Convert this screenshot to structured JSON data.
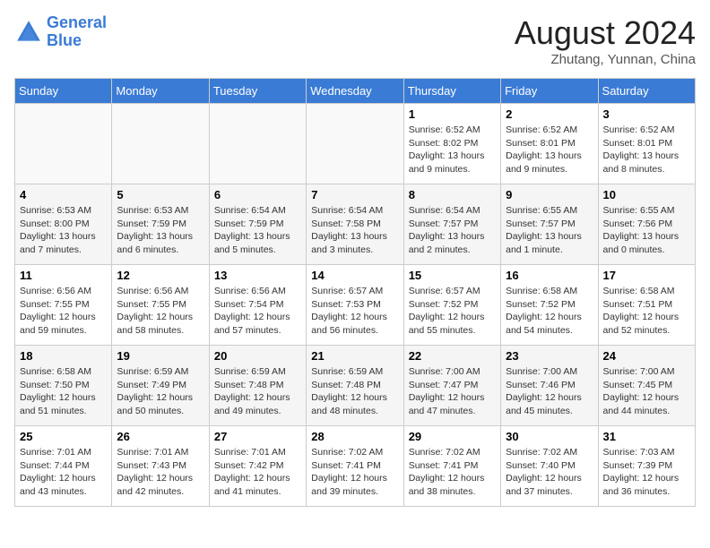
{
  "header": {
    "logo_line1": "General",
    "logo_line2": "Blue",
    "month": "August 2024",
    "location": "Zhutang, Yunnan, China"
  },
  "weekdays": [
    "Sunday",
    "Monday",
    "Tuesday",
    "Wednesday",
    "Thursday",
    "Friday",
    "Saturday"
  ],
  "weeks": [
    [
      {
        "day": "",
        "info": ""
      },
      {
        "day": "",
        "info": ""
      },
      {
        "day": "",
        "info": ""
      },
      {
        "day": "",
        "info": ""
      },
      {
        "day": "1",
        "info": "Sunrise: 6:52 AM\nSunset: 8:02 PM\nDaylight: 13 hours\nand 9 minutes."
      },
      {
        "day": "2",
        "info": "Sunrise: 6:52 AM\nSunset: 8:01 PM\nDaylight: 13 hours\nand 9 minutes."
      },
      {
        "day": "3",
        "info": "Sunrise: 6:52 AM\nSunset: 8:01 PM\nDaylight: 13 hours\nand 8 minutes."
      }
    ],
    [
      {
        "day": "4",
        "info": "Sunrise: 6:53 AM\nSunset: 8:00 PM\nDaylight: 13 hours\nand 7 minutes."
      },
      {
        "day": "5",
        "info": "Sunrise: 6:53 AM\nSunset: 7:59 PM\nDaylight: 13 hours\nand 6 minutes."
      },
      {
        "day": "6",
        "info": "Sunrise: 6:54 AM\nSunset: 7:59 PM\nDaylight: 13 hours\nand 5 minutes."
      },
      {
        "day": "7",
        "info": "Sunrise: 6:54 AM\nSunset: 7:58 PM\nDaylight: 13 hours\nand 3 minutes."
      },
      {
        "day": "8",
        "info": "Sunrise: 6:54 AM\nSunset: 7:57 PM\nDaylight: 13 hours\nand 2 minutes."
      },
      {
        "day": "9",
        "info": "Sunrise: 6:55 AM\nSunset: 7:57 PM\nDaylight: 13 hours\nand 1 minute."
      },
      {
        "day": "10",
        "info": "Sunrise: 6:55 AM\nSunset: 7:56 PM\nDaylight: 13 hours\nand 0 minutes."
      }
    ],
    [
      {
        "day": "11",
        "info": "Sunrise: 6:56 AM\nSunset: 7:55 PM\nDaylight: 12 hours\nand 59 minutes."
      },
      {
        "day": "12",
        "info": "Sunrise: 6:56 AM\nSunset: 7:55 PM\nDaylight: 12 hours\nand 58 minutes."
      },
      {
        "day": "13",
        "info": "Sunrise: 6:56 AM\nSunset: 7:54 PM\nDaylight: 12 hours\nand 57 minutes."
      },
      {
        "day": "14",
        "info": "Sunrise: 6:57 AM\nSunset: 7:53 PM\nDaylight: 12 hours\nand 56 minutes."
      },
      {
        "day": "15",
        "info": "Sunrise: 6:57 AM\nSunset: 7:52 PM\nDaylight: 12 hours\nand 55 minutes."
      },
      {
        "day": "16",
        "info": "Sunrise: 6:58 AM\nSunset: 7:52 PM\nDaylight: 12 hours\nand 54 minutes."
      },
      {
        "day": "17",
        "info": "Sunrise: 6:58 AM\nSunset: 7:51 PM\nDaylight: 12 hours\nand 52 minutes."
      }
    ],
    [
      {
        "day": "18",
        "info": "Sunrise: 6:58 AM\nSunset: 7:50 PM\nDaylight: 12 hours\nand 51 minutes."
      },
      {
        "day": "19",
        "info": "Sunrise: 6:59 AM\nSunset: 7:49 PM\nDaylight: 12 hours\nand 50 minutes."
      },
      {
        "day": "20",
        "info": "Sunrise: 6:59 AM\nSunset: 7:48 PM\nDaylight: 12 hours\nand 49 minutes."
      },
      {
        "day": "21",
        "info": "Sunrise: 6:59 AM\nSunset: 7:48 PM\nDaylight: 12 hours\nand 48 minutes."
      },
      {
        "day": "22",
        "info": "Sunrise: 7:00 AM\nSunset: 7:47 PM\nDaylight: 12 hours\nand 47 minutes."
      },
      {
        "day": "23",
        "info": "Sunrise: 7:00 AM\nSunset: 7:46 PM\nDaylight: 12 hours\nand 45 minutes."
      },
      {
        "day": "24",
        "info": "Sunrise: 7:00 AM\nSunset: 7:45 PM\nDaylight: 12 hours\nand 44 minutes."
      }
    ],
    [
      {
        "day": "25",
        "info": "Sunrise: 7:01 AM\nSunset: 7:44 PM\nDaylight: 12 hours\nand 43 minutes."
      },
      {
        "day": "26",
        "info": "Sunrise: 7:01 AM\nSunset: 7:43 PM\nDaylight: 12 hours\nand 42 minutes."
      },
      {
        "day": "27",
        "info": "Sunrise: 7:01 AM\nSunset: 7:42 PM\nDaylight: 12 hours\nand 41 minutes."
      },
      {
        "day": "28",
        "info": "Sunrise: 7:02 AM\nSunset: 7:41 PM\nDaylight: 12 hours\nand 39 minutes."
      },
      {
        "day": "29",
        "info": "Sunrise: 7:02 AM\nSunset: 7:41 PM\nDaylight: 12 hours\nand 38 minutes."
      },
      {
        "day": "30",
        "info": "Sunrise: 7:02 AM\nSunset: 7:40 PM\nDaylight: 12 hours\nand 37 minutes."
      },
      {
        "day": "31",
        "info": "Sunrise: 7:03 AM\nSunset: 7:39 PM\nDaylight: 12 hours\nand 36 minutes."
      }
    ]
  ]
}
